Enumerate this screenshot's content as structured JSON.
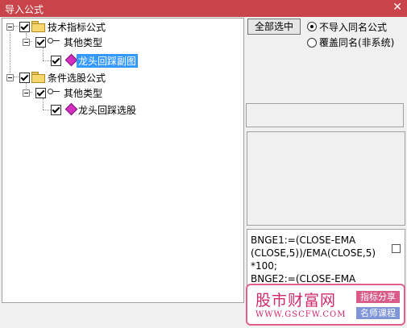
{
  "window": {
    "title": "导入公式",
    "close_glyph": "✕"
  },
  "tree": {
    "items": [
      {
        "label": "技术指标公式"
      },
      {
        "label": "其他类型"
      },
      {
        "label": "龙头回踩副图"
      },
      {
        "label": "条件选股公式"
      },
      {
        "label": "其他类型"
      },
      {
        "label": "龙头回踩选股"
      }
    ]
  },
  "options": {
    "select_all_label": "全部选中",
    "radio_skip_label": "不导入同名公式",
    "radio_overwrite_label": "覆盖同名(非系统)",
    "selected_radio": "skip"
  },
  "code": {
    "lines": [
      "BNGE1:=(CLOSE-EMA",
      "(CLOSE,5))/EMA(CLOSE,5)",
      "*100;",
      "BNGE2:=(CLOSE-EMA"
    ]
  },
  "watermark": {
    "name": "股市财富网",
    "url": "WWW.GSCFW.COM",
    "tag1": "指标分享",
    "tag2": "名师课程"
  },
  "colors": {
    "titlebar": "#c9444a",
    "selection": "#3399ff",
    "watermark": "#d0296e"
  }
}
